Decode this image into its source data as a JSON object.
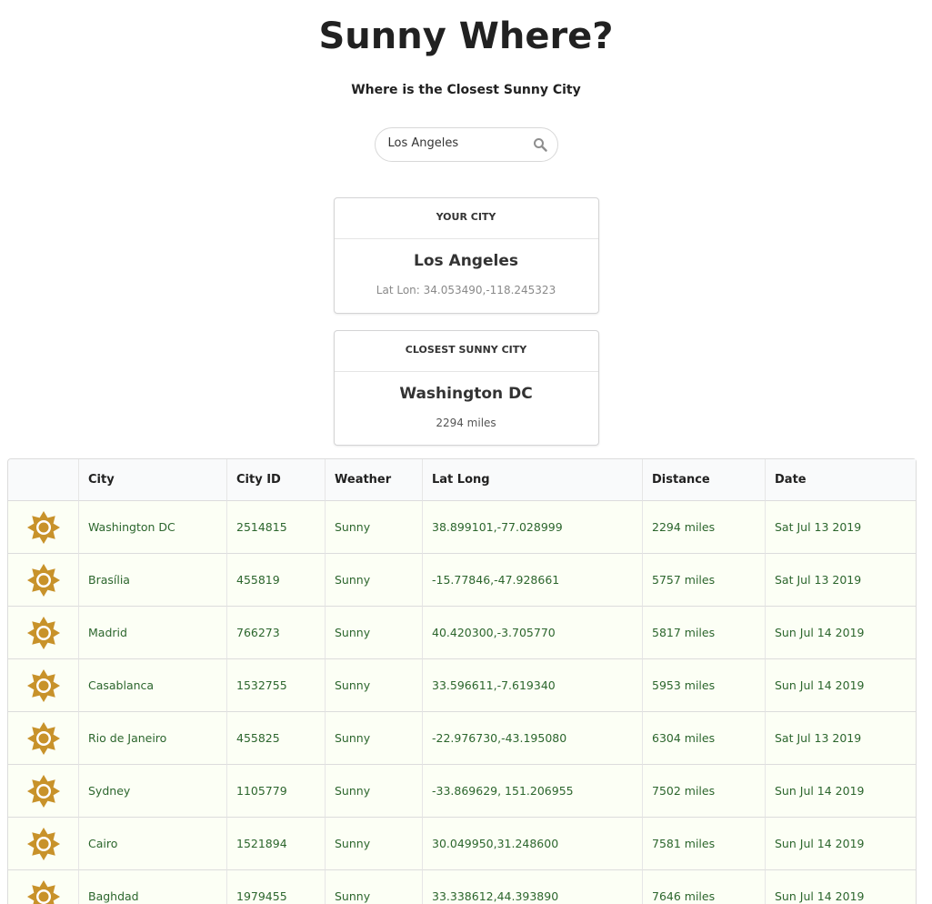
{
  "header": {
    "title": "Sunny Where?",
    "subtitle": "Where is the Closest Sunny City"
  },
  "search": {
    "value": "Los Angeles",
    "icon": "search-icon"
  },
  "your_city": {
    "header": "YOUR CITY",
    "name": "Los Angeles",
    "meta": "Lat Lon: 34.053490,-118.245323"
  },
  "closest_city": {
    "header": "CLOSEST SUNNY CITY",
    "name": "Washington DC",
    "distance": "2294 miles"
  },
  "table": {
    "columns": [
      "",
      "City",
      "City ID",
      "Weather",
      "Lat Long",
      "Distance",
      "Date"
    ],
    "rows": [
      {
        "icon": "sun-icon",
        "city": "Washington DC",
        "id": "2514815",
        "weather": "Sunny",
        "latlong": "38.899101,-77.028999",
        "distance": "2294 miles",
        "date": "Sat Jul 13 2019"
      },
      {
        "icon": "sun-icon",
        "city": "Brasília",
        "id": "455819",
        "weather": "Sunny",
        "latlong": "-15.77846,-47.928661",
        "distance": "5757 miles",
        "date": "Sat Jul 13 2019"
      },
      {
        "icon": "sun-icon",
        "city": "Madrid",
        "id": "766273",
        "weather": "Sunny",
        "latlong": "40.420300,-3.705770",
        "distance": "5817 miles",
        "date": "Sun Jul 14 2019"
      },
      {
        "icon": "sun-icon",
        "city": "Casablanca",
        "id": "1532755",
        "weather": "Sunny",
        "latlong": "33.596611,-7.619340",
        "distance": "5953 miles",
        "date": "Sun Jul 14 2019"
      },
      {
        "icon": "sun-icon",
        "city": "Rio de Janeiro",
        "id": "455825",
        "weather": "Sunny",
        "latlong": "-22.976730,-43.195080",
        "distance": "6304 miles",
        "date": "Sat Jul 13 2019"
      },
      {
        "icon": "sun-icon",
        "city": "Sydney",
        "id": "1105779",
        "weather": "Sunny",
        "latlong": "-33.869629, 151.206955",
        "distance": "7502 miles",
        "date": "Sun Jul 14 2019"
      },
      {
        "icon": "sun-icon",
        "city": "Cairo",
        "id": "1521894",
        "weather": "Sunny",
        "latlong": "30.049950,31.248600",
        "distance": "7581 miles",
        "date": "Sun Jul 14 2019"
      },
      {
        "icon": "sun-icon",
        "city": "Baghdad",
        "id": "1979455",
        "weather": "Sunny",
        "latlong": "33.338612,44.393890",
        "distance": "7646 miles",
        "date": "Sun Jul 14 2019"
      }
    ]
  },
  "colors": {
    "row_text": "#2c662d",
    "row_bg": "#fcfff5",
    "sun": "#c8922a"
  }
}
